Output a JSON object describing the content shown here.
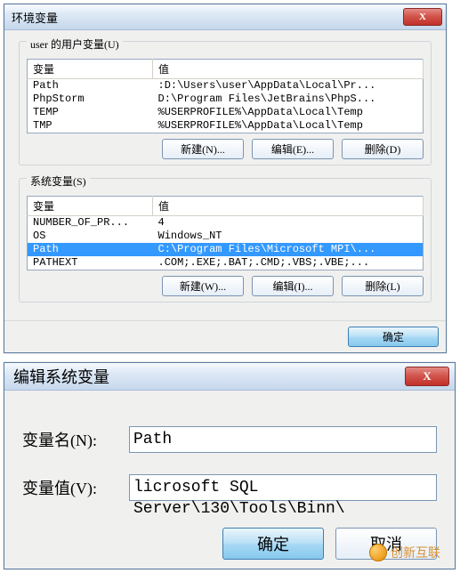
{
  "env_dialog": {
    "title": "环境变量",
    "close_glyph": "X",
    "user_group_label": "user 的用户变量(U)",
    "system_group_label": "系统变量(S)",
    "col_var": "变量",
    "col_val": "值",
    "user_rows": [
      {
        "name": "Path",
        "value": ":D:\\Users\\user\\AppData\\Local\\Pr..."
      },
      {
        "name": "PhpStorm",
        "value": "D:\\Program Files\\JetBrains\\PhpS..."
      },
      {
        "name": "TEMP",
        "value": "%USERPROFILE%\\AppData\\Local\\Temp"
      },
      {
        "name": "TMP",
        "value": "%USERPROFILE%\\AppData\\Local\\Temp"
      }
    ],
    "sys_rows": [
      {
        "name": "NUMBER_OF_PR...",
        "value": "4",
        "selected": false
      },
      {
        "name": "OS",
        "value": "Windows_NT",
        "selected": false
      },
      {
        "name": "Path",
        "value": "C:\\Program Files\\Microsoft MPI\\...",
        "selected": true
      },
      {
        "name": "PATHEXT",
        "value": ".COM;.EXE;.BAT;.CMD;.VBS;.VBE;...",
        "selected": false
      }
    ],
    "buttons": {
      "new_u": "新建(N)...",
      "edit_u": "编辑(E)...",
      "del_u": "删除(D)",
      "new_s": "新建(W)...",
      "edit_s": "编辑(I)...",
      "del_s": "删除(L)",
      "ok": "确定"
    }
  },
  "edit_dialog": {
    "title": "编辑系统变量",
    "close_glyph": "X",
    "name_label": "变量名(N):",
    "value_label": "变量值(V):",
    "name_value": "Path",
    "value_value": "licrosoft SQL Server\\130\\Tools\\Binn\\",
    "ok": "确定",
    "cancel": "取消"
  },
  "watermark": "创新互联"
}
